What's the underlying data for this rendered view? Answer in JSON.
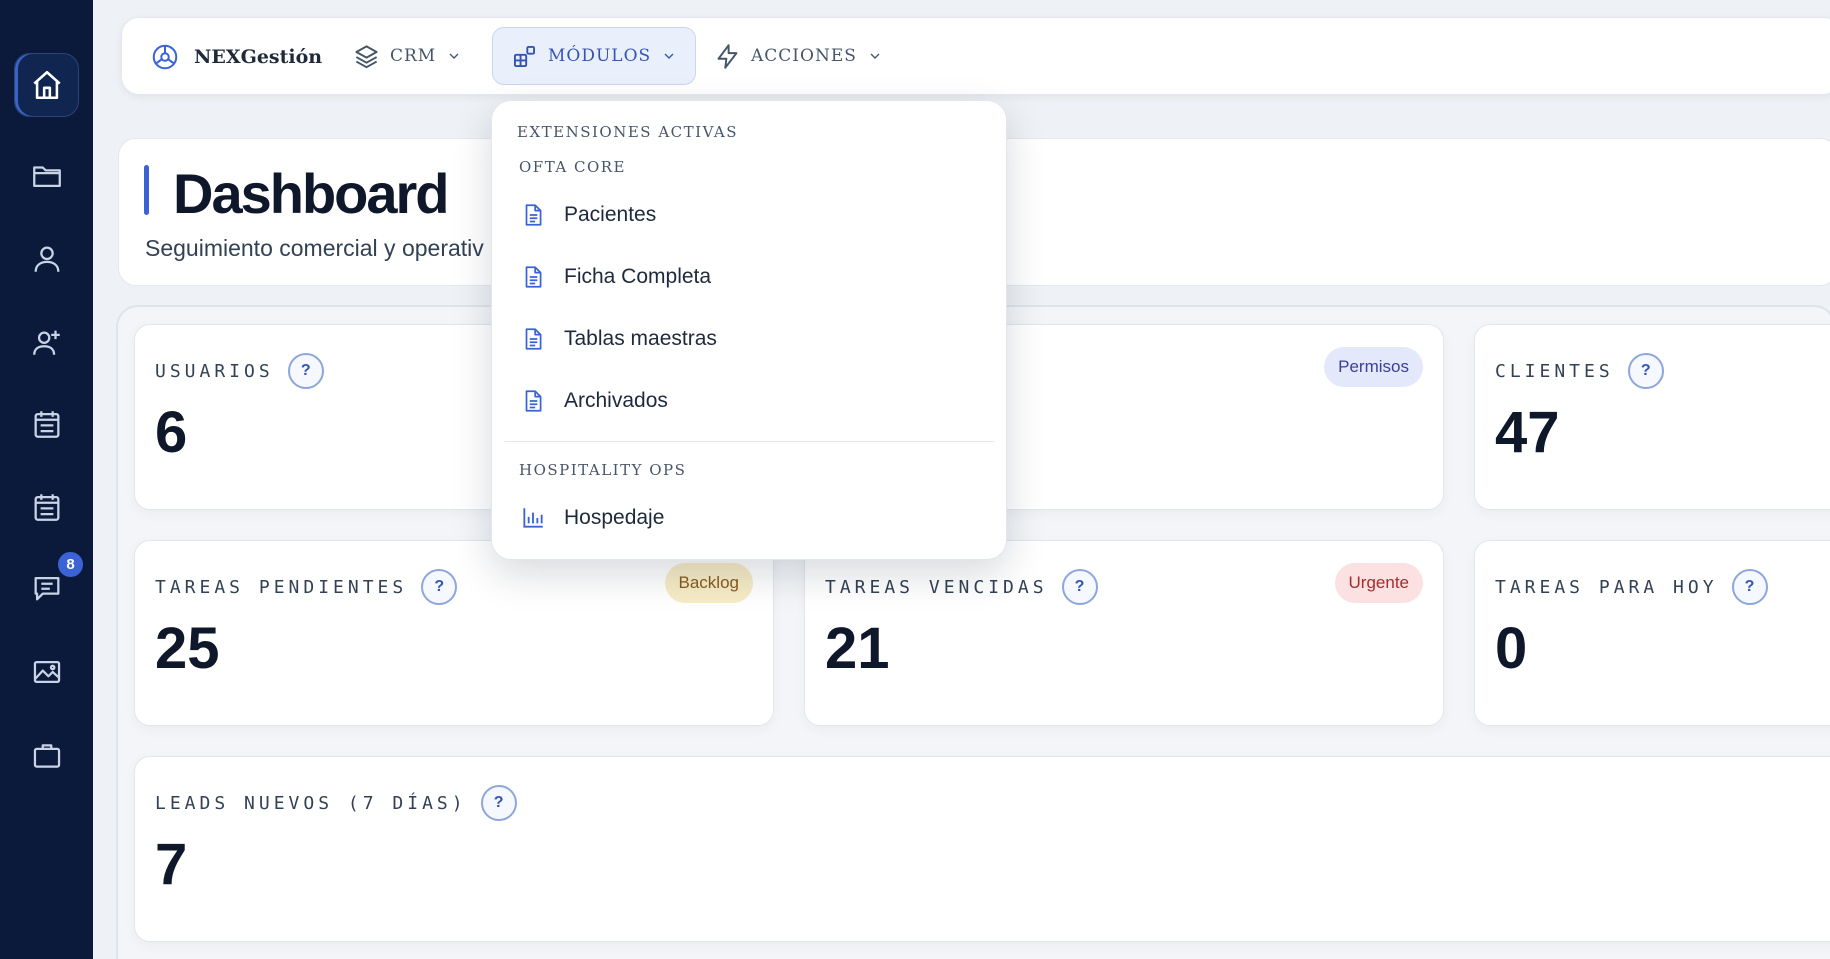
{
  "sidebar": {
    "items": [
      {
        "icon": "home-icon"
      },
      {
        "icon": "folder-icon"
      },
      {
        "icon": "user-icon"
      },
      {
        "icon": "user-plus-icon"
      },
      {
        "icon": "calendar-list-icon"
      },
      {
        "icon": "calendar-list-icon"
      },
      {
        "icon": "chat-icon",
        "badge": "8"
      },
      {
        "icon": "image-icon"
      },
      {
        "icon": "briefcase-icon"
      }
    ]
  },
  "topnav": {
    "brand": "NEXGestión",
    "crm": "CRM",
    "modulos": "MÓDULOS",
    "acciones": "ACCIONES"
  },
  "header": {
    "title": "Dashboard",
    "subtitle": "Seguimiento comercial y operativ"
  },
  "stats": {
    "usuarios": {
      "label": "USUARIOS",
      "value": "6"
    },
    "permisos_card": {
      "pill": "Permisos"
    },
    "clientes": {
      "label": "CLIENTES",
      "value": "47"
    },
    "tareas_pendientes": {
      "label": "TAREAS PENDIENTES",
      "value": "25",
      "pill": "Backlog"
    },
    "tareas_vencidas": {
      "label": "TAREAS VENCIDAS",
      "value": "21",
      "pill": "Urgente"
    },
    "tareas_hoy": {
      "label": "TAREAS PARA HOY",
      "value": "0"
    },
    "leads": {
      "label": "LEADS NUEVOS (7 DÍAS)",
      "value": "7"
    },
    "help_glyph": "?"
  },
  "dropdown": {
    "heading": "EXTENSIONES ACTIVAS",
    "group1": {
      "title": "OFTA CORE",
      "items": [
        "Pacientes",
        "Ficha Completa",
        "Tablas maestras",
        "Archivados"
      ]
    },
    "group2": {
      "title": "HOSPITALITY OPS",
      "items": [
        "Hospedaje"
      ]
    }
  },
  "colors": {
    "sidebar_bg": "#0b1a3b",
    "accent": "#3b63d6",
    "page_bg": "#eef1f5"
  }
}
